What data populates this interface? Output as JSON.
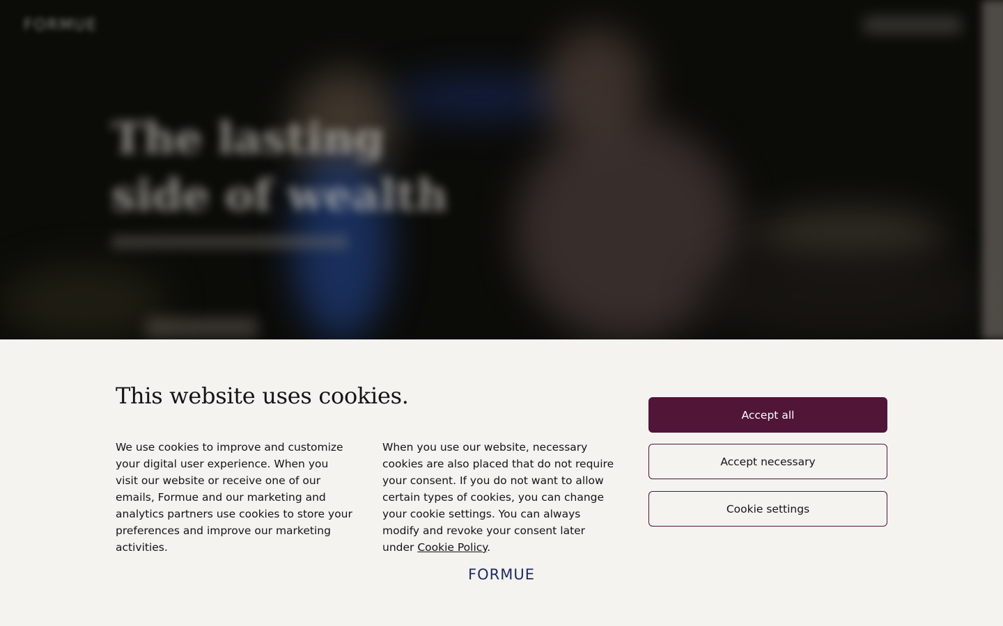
{
  "hero": {
    "logo_text": "FORMUE",
    "title": "The lasting side of wealth"
  },
  "cookie_banner": {
    "title": "This website uses cookies.",
    "paragraph_left": "We use cookies to improve and customize your digital user experience. When you visit our website or receive one of our emails, Formue and our marketing and analytics partners use cookies to store your preferences and improve our marketing activities.",
    "paragraph_right_before_link": "When you use our website, necessary cookies are also placed that do not require your consent. If you do not want to allow certain types of cookies, you can change your cookie settings. You can always modify and revoke your consent later under ",
    "paragraph_right_link": "Cookie Policy",
    "paragraph_right_after_link": ".",
    "buttons": {
      "accept_all": "Accept all",
      "accept_necessary": "Accept necessary",
      "cookie_settings": "Cookie settings"
    },
    "logo_text": "FORMUE"
  },
  "colors": {
    "brand_primary": "#511538",
    "logo_navy": "#1e2a5e",
    "banner_bg": "#f4f3f0"
  }
}
